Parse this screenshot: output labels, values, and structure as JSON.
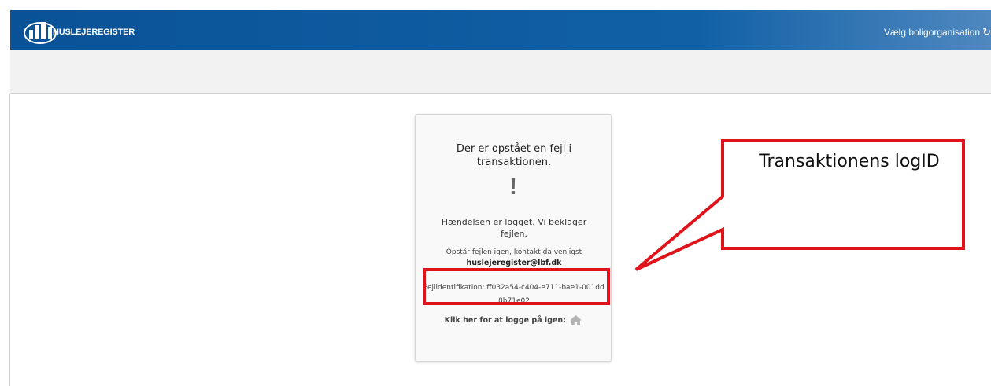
{
  "header": {
    "brand": "HUSLEJEREGISTER",
    "org_select_label": "Vælg boligorganisation",
    "logo_icon": "house-logo-icon",
    "refresh_icon": "refresh-icon",
    "background": "#0a5297"
  },
  "error_card": {
    "title": "Der er opstået en fejl i transaktionen.",
    "exclamation": "!",
    "logged_message": "Hændelsen er logget. Vi beklager fejlen.",
    "contact_text": "Opstår fejlen igen, kontakt da venligst",
    "contact_email": "huslejeregister@lbf.dk",
    "error_id_label": "Fejlidentifikation:",
    "error_id_value": "ff032a54-c404-e711-bae1-001dd8b71e02",
    "login_text": "Klik her for at logge på igen:",
    "home_icon": "home-icon"
  },
  "annotation": {
    "label": "Transaktionens logID",
    "color": "#e0131a"
  }
}
